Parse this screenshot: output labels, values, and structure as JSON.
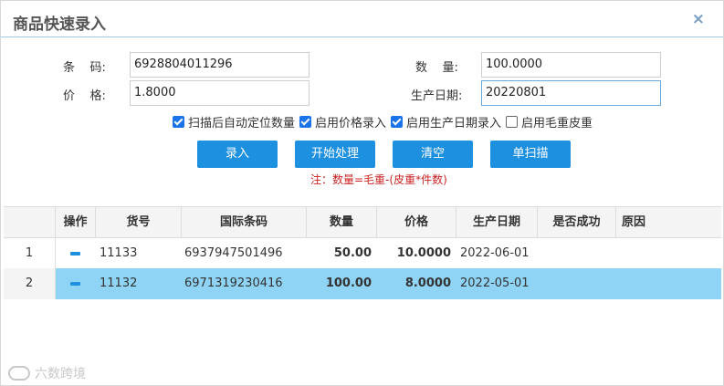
{
  "dialog": {
    "title": "商品快速录入",
    "close_glyph": "×"
  },
  "form": {
    "barcode_label": "条    码:",
    "barcode_value": "6928804011296",
    "price_label": "价    格:",
    "price_value": "1.8000",
    "qty_label": "数    量:",
    "qty_value": "100.0000",
    "date_label": "生产日期:",
    "date_value": "20220801"
  },
  "options": [
    {
      "label": "扫描后自动定位数量",
      "checked": true
    },
    {
      "label": "启用价格录入",
      "checked": true
    },
    {
      "label": "启用生产日期录入",
      "checked": true
    },
    {
      "label": "启用毛重皮重",
      "checked": false
    }
  ],
  "buttons": {
    "enter": "录入",
    "process": "开始处理",
    "clear": "清空",
    "single_scan": "单扫描"
  },
  "note": "注：数量=毛重-(皮重*件数)",
  "table": {
    "columns": [
      "操作",
      "货号",
      "国际条码",
      "数量",
      "价格",
      "生产日期",
      "是否成功",
      "原因"
    ],
    "rows": [
      {
        "no": "1",
        "item_no": "11133",
        "barcode": "6937947501496",
        "qty": "50.00",
        "price": "10.0000",
        "date": "2022-06-01",
        "success": "",
        "reason": "",
        "selected": false
      },
      {
        "no": "2",
        "item_no": "11132",
        "barcode": "6971319230416",
        "qty": "100.00",
        "price": "8.0000",
        "date": "2022-05-01",
        "success": "",
        "reason": "",
        "selected": true
      }
    ]
  },
  "watermark": "六数跨境",
  "colors": {
    "accent": "#1e90e0",
    "selected_row": "#8fd4f4",
    "note": "#cc2222",
    "check": "#1a73e8"
  }
}
